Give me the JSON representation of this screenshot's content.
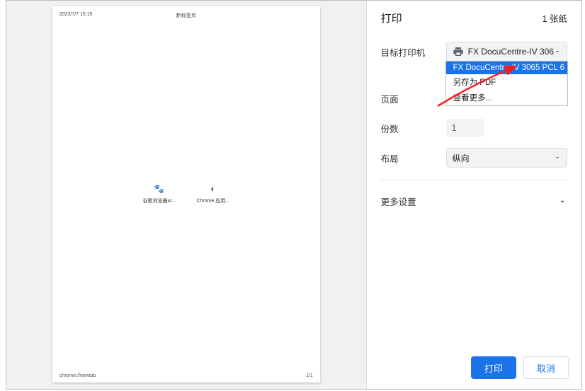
{
  "preview": {
    "timestamp": "2023/7/7 15:15",
    "pageTitle": "新标签页",
    "footerLeft": "chrome://newtab",
    "footerRight": "1/1",
    "shortcuts": [
      {
        "glyph": "🐾",
        "label": "谷歌浏览器ur..."
      },
      {
        "glyph": "◐",
        "label": "Chrome 应用..."
      }
    ]
  },
  "settings": {
    "title": "打印",
    "sheetCount": "1 张纸",
    "labels": {
      "destination": "目标打印机",
      "pages": "页面",
      "copies": "份数",
      "layout": "布局",
      "moreSettings": "更多设置"
    },
    "destination": {
      "selected": "FX DocuCentre-IV 306",
      "options": [
        "FX DocuCentre-IV 3065 PCL 6",
        "另存为 PDF",
        "查看更多..."
      ],
      "highlightedIndex": 0
    },
    "pagesValue": "",
    "copiesValue": "1",
    "layoutValue": "纵向"
  },
  "buttons": {
    "print": "打印",
    "cancel": "取消"
  }
}
